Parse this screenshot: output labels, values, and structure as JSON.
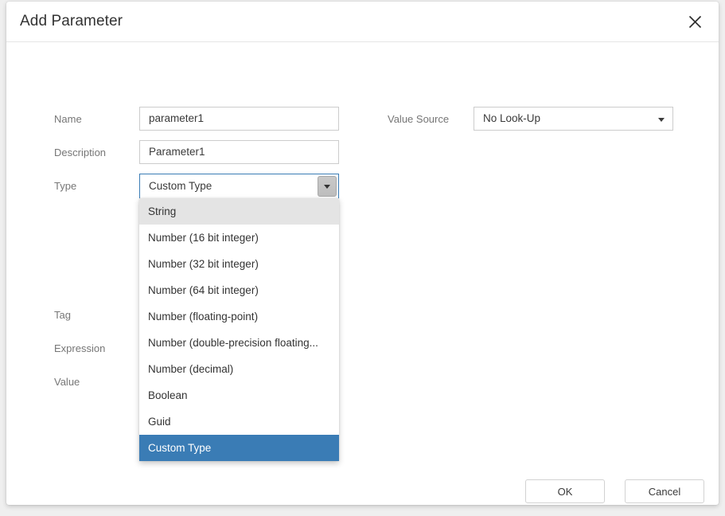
{
  "dialog": {
    "title": "Add Parameter",
    "close_icon": "close-icon"
  },
  "form": {
    "name": {
      "label": "Name",
      "value": "parameter1"
    },
    "description": {
      "label": "Description",
      "value": "Parameter1"
    },
    "type": {
      "label": "Type",
      "value": "Custom Type",
      "arrow_icon": "chevron-down-icon"
    },
    "tag": {
      "label": "Tag"
    },
    "expression": {
      "label": "Expression"
    },
    "value": {
      "label": "Value"
    },
    "value_source": {
      "label": "Value Source",
      "value": "No Look-Up",
      "arrow_icon": "chevron-down-icon"
    }
  },
  "type_dropdown": {
    "options": [
      "String",
      "Number (16 bit integer)",
      "Number (32 bit integer)",
      "Number (64 bit integer)",
      "Number (floating-point)",
      "Number (double-precision floating...",
      "Number (decimal)",
      "Boolean",
      "Guid",
      "Custom Type"
    ],
    "selected": "Custom Type",
    "hovered": "String"
  },
  "footer": {
    "ok_label": "OK",
    "cancel_label": "Cancel"
  },
  "colors": {
    "selection_blue": "#3a7cb5",
    "focus_border": "#3a7cb5",
    "hover_gray": "#e4e4e4",
    "label_gray": "#767676",
    "border_gray": "#cccccc"
  }
}
